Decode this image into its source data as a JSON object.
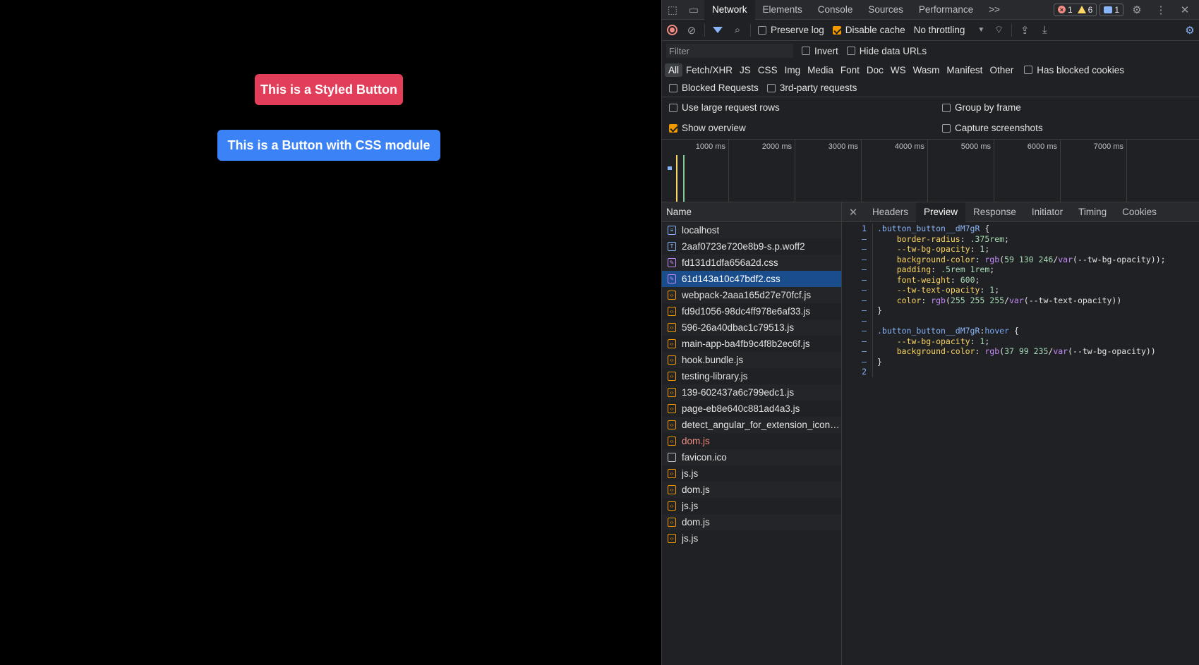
{
  "page": {
    "styled_button": "This is a Styled Button",
    "module_button": "This is a Button with CSS module",
    "styled_color": "#e23e5a",
    "module_color": "#3b82f6"
  },
  "devtools": {
    "tabs": [
      "Network",
      "Elements",
      "Console",
      "Sources",
      "Performance"
    ],
    "active_tab": "Network",
    "more_tabs": ">>",
    "badges": {
      "errors": "1",
      "warnings": "6",
      "messages": "1"
    },
    "toolbar": {
      "preserve_log": "Preserve log",
      "disable_cache": "Disable cache",
      "throttling": "No throttling"
    },
    "filter": {
      "placeholder": "Filter",
      "invert": "Invert",
      "hide_data_urls": "Hide data URLs"
    },
    "types": [
      "All",
      "Fetch/XHR",
      "JS",
      "CSS",
      "Img",
      "Media",
      "Font",
      "Doc",
      "WS",
      "Wasm",
      "Manifest",
      "Other"
    ],
    "has_blocked_cookies": "Has blocked cookies",
    "blocked_requests": "Blocked Requests",
    "third_party": "3rd-party requests",
    "options": {
      "large_rows": "Use large request rows",
      "group_by_frame": "Group by frame",
      "show_overview": "Show overview",
      "capture_screenshots": "Capture screenshots"
    },
    "overview_ticks": [
      "1000 ms",
      "2000 ms",
      "3000 ms",
      "4000 ms",
      "5000 ms",
      "6000 ms",
      "7000 ms"
    ],
    "list_header": "Name",
    "requests": [
      {
        "name": "localhost",
        "type": "doc"
      },
      {
        "name": "2aaf0723e720e8b9-s.p.woff2",
        "type": "font"
      },
      {
        "name": "fd131d1dfa656a2d.css",
        "type": "css"
      },
      {
        "name": "61d143a10c47bdf2.css",
        "type": "css",
        "selected": true
      },
      {
        "name": "webpack-2aaa165d27e70fcf.js",
        "type": "js"
      },
      {
        "name": "fd9d1056-98dc4ff978e6af33.js",
        "type": "js"
      },
      {
        "name": "596-26a40dbac1c79513.js",
        "type": "js"
      },
      {
        "name": "main-app-ba4fb9c4f8b2ec6f.js",
        "type": "js"
      },
      {
        "name": "hook.bundle.js",
        "type": "js"
      },
      {
        "name": "testing-library.js",
        "type": "js"
      },
      {
        "name": "139-602437a6c799edc1.js",
        "type": "js"
      },
      {
        "name": "page-eb8e640c881ad4a3.js",
        "type": "js"
      },
      {
        "name": "detect_angular_for_extension_icon…",
        "type": "js"
      },
      {
        "name": "dom.js",
        "type": "js",
        "error": true
      },
      {
        "name": "favicon.ico",
        "type": "plain"
      },
      {
        "name": "js.js",
        "type": "js"
      },
      {
        "name": "dom.js",
        "type": "js"
      },
      {
        "name": "js.js",
        "type": "js"
      },
      {
        "name": "dom.js",
        "type": "js"
      },
      {
        "name": "js.js",
        "type": "js"
      }
    ],
    "detail_tabs": [
      "Headers",
      "Preview",
      "Response",
      "Initiator",
      "Timing",
      "Cookies"
    ],
    "active_detail_tab": "Preview",
    "code_lines": [
      {
        "n": "1",
        "parts": [
          [
            "sel-c",
            ".button_button__dM7gR"
          ],
          [
            "val",
            " {"
          ]
        ]
      },
      {
        "n": "–",
        "parts": [
          [
            "prop",
            "    border-radius"
          ],
          [
            "val",
            ": "
          ],
          [
            "num",
            ".375rem"
          ],
          [
            "val",
            ";"
          ]
        ]
      },
      {
        "n": "–",
        "parts": [
          [
            "prop",
            "    --tw-bg-opacity"
          ],
          [
            "val",
            ": "
          ],
          [
            "num",
            "1"
          ],
          [
            "val",
            ";"
          ]
        ]
      },
      {
        "n": "–",
        "parts": [
          [
            "prop",
            "    background-color"
          ],
          [
            "val",
            ": "
          ],
          [
            "fn",
            "rgb"
          ],
          [
            "val",
            "("
          ],
          [
            "num",
            "59 130 246"
          ],
          [
            "val",
            "/"
          ],
          [
            "fn",
            "var"
          ],
          [
            "val",
            "(--tw-bg-opacity));"
          ]
        ]
      },
      {
        "n": "–",
        "parts": [
          [
            "prop",
            "    padding"
          ],
          [
            "val",
            ": "
          ],
          [
            "num",
            ".5rem 1rem"
          ],
          [
            "val",
            ";"
          ]
        ]
      },
      {
        "n": "–",
        "parts": [
          [
            "prop",
            "    font-weight"
          ],
          [
            "val",
            ": "
          ],
          [
            "num",
            "600"
          ],
          [
            "val",
            ";"
          ]
        ]
      },
      {
        "n": "–",
        "parts": [
          [
            "prop",
            "    --tw-text-opacity"
          ],
          [
            "val",
            ": "
          ],
          [
            "num",
            "1"
          ],
          [
            "val",
            ";"
          ]
        ]
      },
      {
        "n": "–",
        "parts": [
          [
            "prop",
            "    color"
          ],
          [
            "val",
            ": "
          ],
          [
            "fn",
            "rgb"
          ],
          [
            "val",
            "("
          ],
          [
            "num",
            "255 255 255"
          ],
          [
            "val",
            "/"
          ],
          [
            "fn",
            "var"
          ],
          [
            "val",
            "(--tw-text-opacity))"
          ]
        ]
      },
      {
        "n": "–",
        "parts": [
          [
            "val",
            "}"
          ]
        ]
      },
      {
        "n": "–",
        "parts": [
          [
            "val",
            ""
          ]
        ]
      },
      {
        "n": "–",
        "parts": [
          [
            "sel-c",
            ".button_button__dM7gR"
          ],
          [
            "val",
            ":"
          ],
          [
            "pseudo",
            "hover"
          ],
          [
            "val",
            " {"
          ]
        ]
      },
      {
        "n": "–",
        "parts": [
          [
            "prop",
            "    --tw-bg-opacity"
          ],
          [
            "val",
            ": "
          ],
          [
            "num",
            "1"
          ],
          [
            "val",
            ";"
          ]
        ]
      },
      {
        "n": "–",
        "parts": [
          [
            "prop",
            "    background-color"
          ],
          [
            "val",
            ": "
          ],
          [
            "fn",
            "rgb"
          ],
          [
            "val",
            "("
          ],
          [
            "num",
            "37 99 235"
          ],
          [
            "val",
            "/"
          ],
          [
            "fn",
            "var"
          ],
          [
            "val",
            "(--tw-bg-opacity))"
          ]
        ]
      },
      {
        "n": "–",
        "parts": [
          [
            "val",
            "}"
          ]
        ]
      },
      {
        "n": "2",
        "parts": [
          [
            "val",
            ""
          ]
        ]
      }
    ]
  }
}
